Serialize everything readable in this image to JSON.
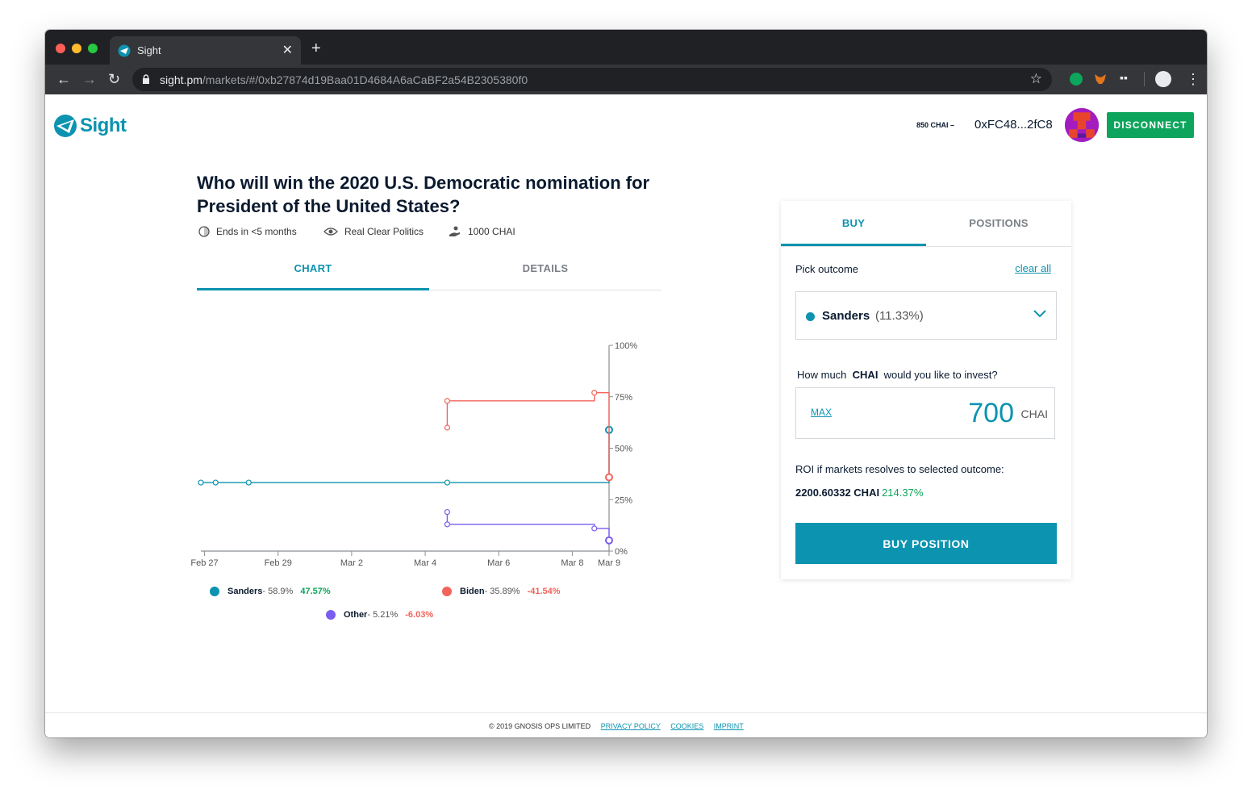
{
  "browser": {
    "tab_title": "Sight",
    "url_host": "sight.pm",
    "url_path": "/markets/#/0xb27874d19Baa01D4684A6aCaBF2a54B2305380f0"
  },
  "header": {
    "logo_text": "Sight",
    "balance": "850 CHAI –",
    "address": "0xFC48...2fC8",
    "disconnect_label": "DISCONNECT"
  },
  "market": {
    "title": "Who will win the 2020 U.S. Democratic nomination for President of the United States?",
    "ends": "Ends in <5 months",
    "oracle": "Real Clear Politics",
    "volume": "1000 CHAI",
    "tabs": [
      "CHART",
      "DETAILS"
    ]
  },
  "chart_data": {
    "type": "line",
    "step": true,
    "x_ticks": [
      "Feb 27",
      "Feb 29",
      "Mar 2",
      "Mar 4",
      "Mar 6",
      "Mar 8",
      "Mar 9"
    ],
    "y_ticks": [
      "100%",
      "75%",
      "50%",
      "25%",
      "0%"
    ],
    "ylim": [
      0,
      100
    ],
    "y_axis_side": "right",
    "series": [
      {
        "name": "Sanders",
        "color": "#0c93b0",
        "points": [
          [
            "Feb 26.9",
            33.3
          ],
          [
            "Feb 27.3",
            33.3
          ],
          [
            "Feb 28.2",
            33.3
          ],
          [
            "Mar 4.6",
            33.3
          ],
          [
            "Mar 9",
            58.9
          ]
        ]
      },
      {
        "name": "Biden",
        "color": "#f2645a",
        "points": [
          [
            "Mar 4.6",
            60.0
          ],
          [
            "Mar 4.6",
            73.0
          ],
          [
            "Mar 8.6",
            77.0
          ],
          [
            "Mar 9",
            35.89
          ]
        ]
      },
      {
        "name": "Other",
        "color": "#7b5cf0",
        "points": [
          [
            "Mar 4.6",
            19.0
          ],
          [
            "Mar 4.6",
            13.0
          ],
          [
            "Mar 8.6",
            11.0
          ],
          [
            "Mar 9",
            5.21
          ]
        ]
      }
    ]
  },
  "legend": [
    {
      "name": "Sanders",
      "value": "- 58.9%",
      "change": "47.57%",
      "dot_color": "#0c93b0",
      "change_color": "#0ca55b"
    },
    {
      "name": "Biden",
      "value": "- 35.89%",
      "change": "-41.54%",
      "dot_color": "#f2645a",
      "change_color": "#f2645a"
    },
    {
      "name": "Other",
      "value": "- 5.21%",
      "change": "-6.03%",
      "dot_color": "#7b5cf0",
      "change_color": "#f2645a"
    }
  ],
  "panel": {
    "tabs": [
      "BUY",
      "POSITIONS"
    ],
    "pick_label": "Pick outcome",
    "clear_all": "clear all",
    "selected_outcome": "Sanders",
    "selected_prob": "(11.33%)",
    "invest_prefix": "How much",
    "invest_token": "CHAI",
    "invest_suffix": "would you like to invest?",
    "max_label": "MAX",
    "amount": "700",
    "amount_unit": "CHAI",
    "roi_label": "ROI if markets resolves to selected outcome:",
    "roi_value": "2200.60332 CHAI",
    "roi_pct": "214.37%",
    "buy_button": "BUY POSITION"
  },
  "footer": {
    "copyright": "© 2019 GNOSIS OPS LIMITED",
    "privacy": "PRIVACY POLICY",
    "cookies": "COOKIES",
    "imprint": "IMPRINT"
  }
}
